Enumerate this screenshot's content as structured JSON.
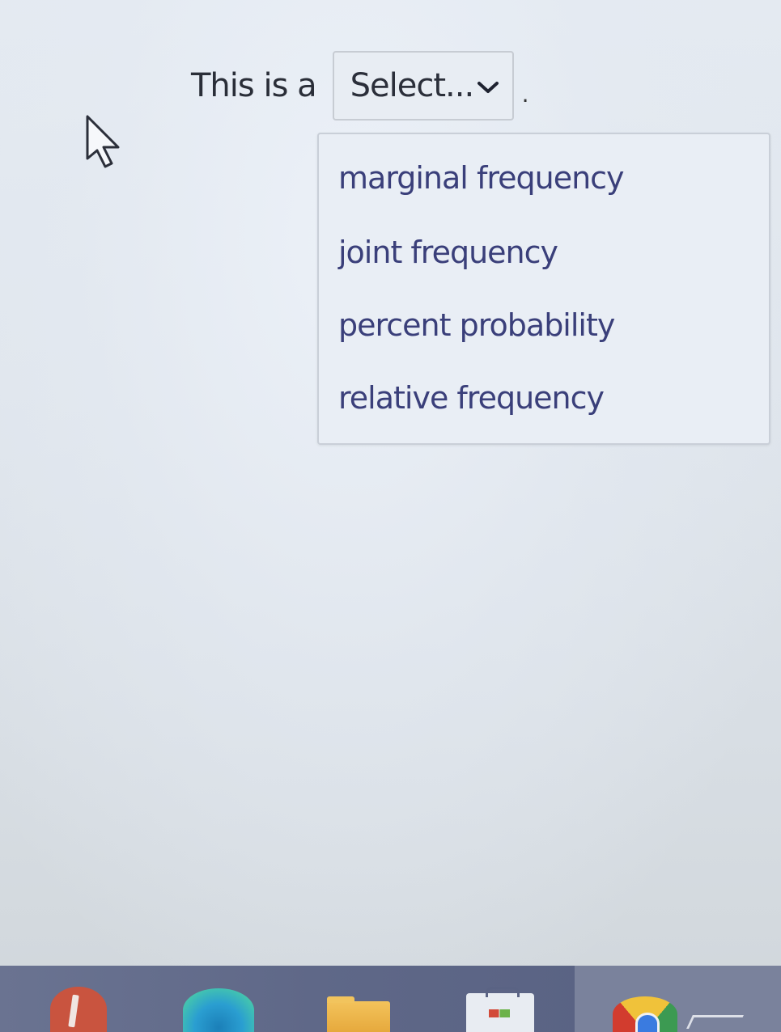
{
  "question": {
    "prompt": "This is a",
    "trailing_punctuation": "."
  },
  "select": {
    "value": "Select...",
    "icon": "chevron-down-icon"
  },
  "dropdown": {
    "options": [
      "marginal frequency",
      "joint frequency",
      "percent probability",
      "relative frequency"
    ]
  },
  "cursor": {
    "icon": "arrow-pointer-icon"
  },
  "taskbar": {
    "apps": [
      {
        "icon": "app-icon"
      },
      {
        "icon": "edge-browser-icon"
      },
      {
        "icon": "file-explorer-icon"
      },
      {
        "icon": "store-icon"
      },
      {
        "icon": "chrome-browser-icon"
      }
    ]
  },
  "colors": {
    "option_text": "#3a3f7a",
    "prompt_text": "#2a2e38",
    "taskbar": "#5f6888"
  }
}
